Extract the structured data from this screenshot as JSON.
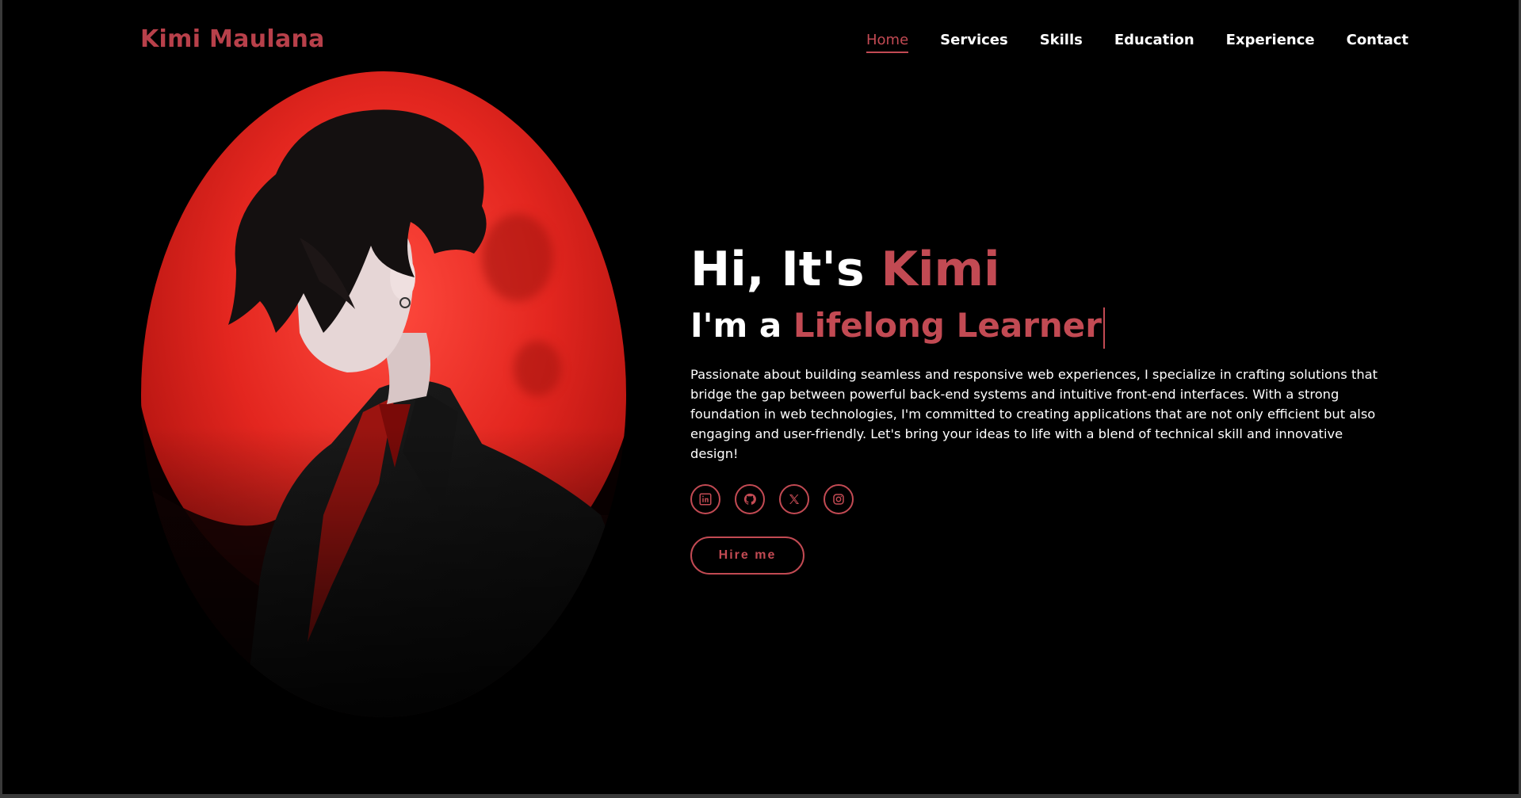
{
  "header": {
    "logo": "Kimi Maulana",
    "nav": [
      {
        "label": "Home",
        "active": true
      },
      {
        "label": "Services",
        "active": false
      },
      {
        "label": "Skills",
        "active": false
      },
      {
        "label": "Education",
        "active": false
      },
      {
        "label": "Experience",
        "active": false
      },
      {
        "label": "Contact",
        "active": false
      }
    ]
  },
  "hero": {
    "greeting_prefix": "Hi, It's",
    "greeting_name": "Kimi",
    "role_prefix": "I'm a",
    "role_text": "Lifelong Learner",
    "bio": "Passionate about building seamless and responsive web experiences, I specialize in crafting solutions that bridge the gap between powerful back-end systems and intuitive front-end interfaces. With a strong foundation in web technologies, I'm committed to creating applications that are not only efficient but also engaging and user-friendly. Let's bring your ideas to life with a blend of technical skill and innovative design!",
    "socials": [
      {
        "icon": "linkedin-icon"
      },
      {
        "icon": "github-icon"
      },
      {
        "icon": "x-twitter-icon"
      },
      {
        "icon": "instagram-icon"
      }
    ],
    "hire_label": "Hire me"
  },
  "colors": {
    "accent": "#c24a53",
    "background": "#000000",
    "text": "#ffffff",
    "moon": "#e3261f"
  }
}
